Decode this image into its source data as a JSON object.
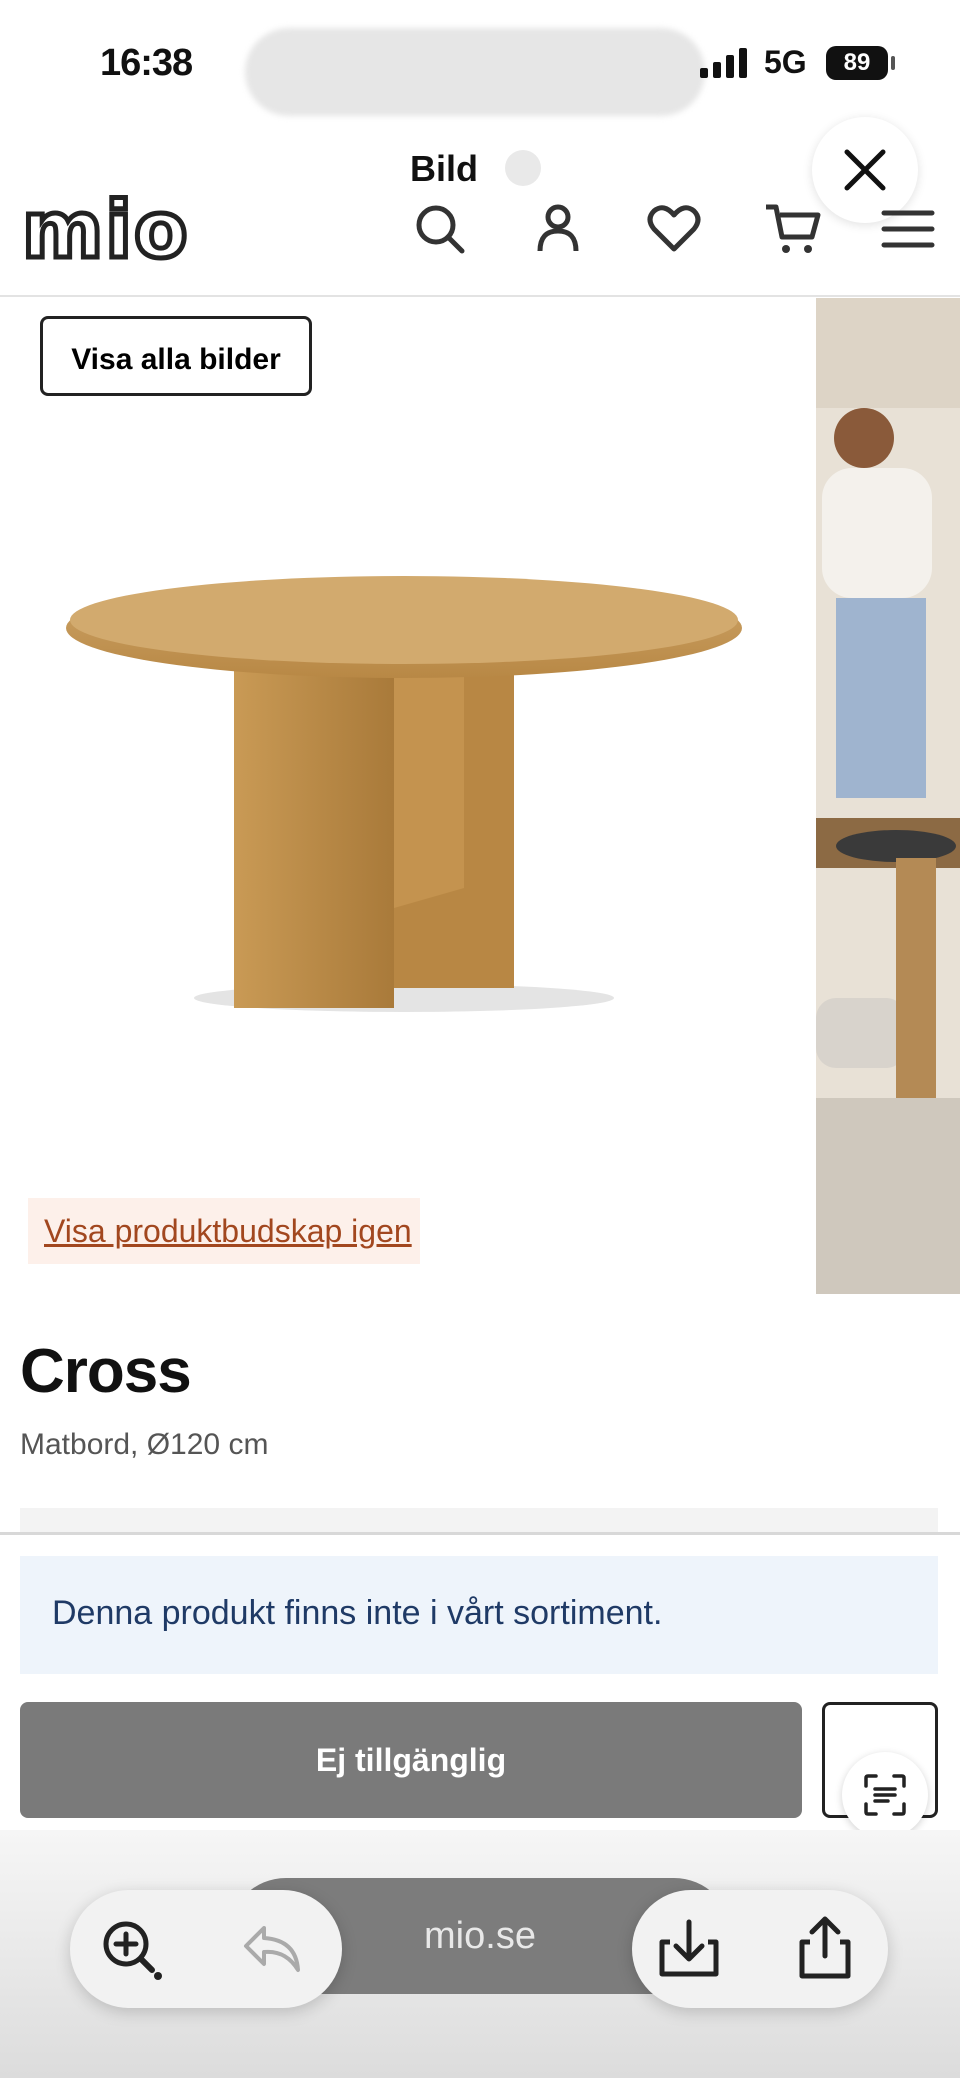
{
  "status_bar": {
    "time": "16:38",
    "network": "5G",
    "battery": "89"
  },
  "overlay": {
    "title": "Bild"
  },
  "site": {
    "logo": "mio"
  },
  "gallery": {
    "show_all_label": "Visa alla bilder",
    "product_message_link": "Visa produktbudskap igen"
  },
  "product": {
    "name": "Cross",
    "subtitle": "Matbord, Ø120 cm",
    "notice": "Denna produkt finns inte i vårt sortiment.",
    "unavailable_label": "Ej tillgänglig"
  },
  "browser": {
    "url": "mio.se"
  }
}
